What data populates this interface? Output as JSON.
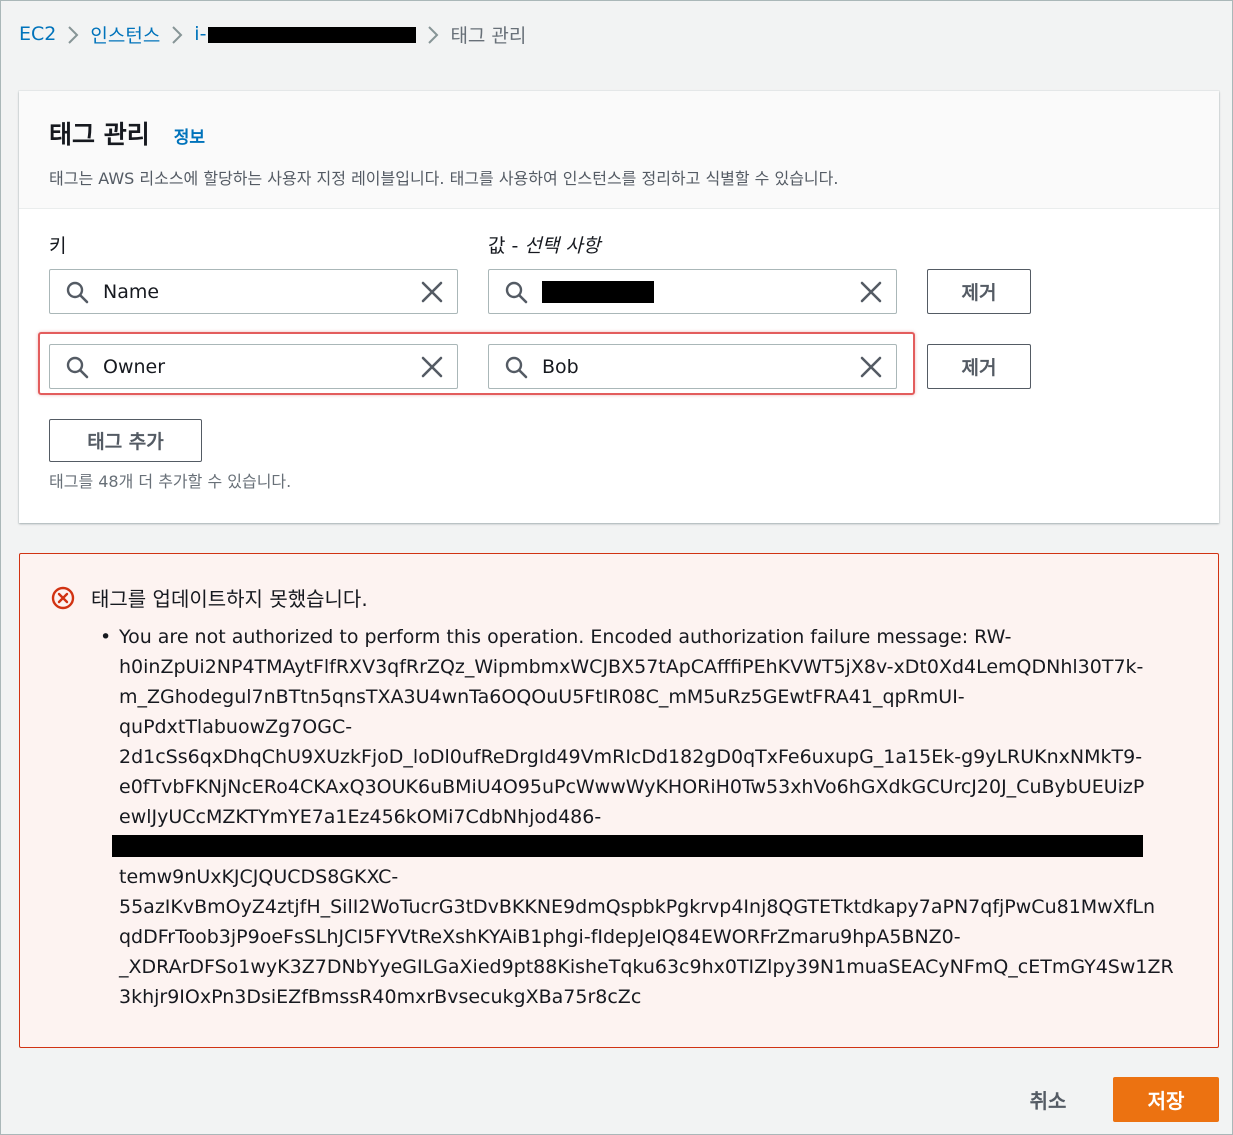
{
  "breadcrumb": {
    "ec2": "EC2",
    "instances": "인스턴스",
    "instance_id_prefix": "i-",
    "current": "태그 관리"
  },
  "panel": {
    "title": "태그 관리",
    "info": "정보",
    "description": "태그는 AWS 리소스에 할당하는 사용자 지정 레이블입니다. 태그를 사용하여 인스턴스를 정리하고 식별할 수 있습니다.",
    "key_label": "키",
    "value_label": "값 - ",
    "value_label_optional": "선택 사항"
  },
  "tags": [
    {
      "key": "Name",
      "value": "",
      "remove_label": "제거"
    },
    {
      "key": "Owner",
      "value": "Bob",
      "remove_label": "제거"
    }
  ],
  "add_tag_label": "태그 추가",
  "add_tag_hint": "태그를 48개 더 추가할 수 있습니다.",
  "alert": {
    "title": "태그를 업데이트하지 못했습니다.",
    "lines": [
      "You are not authorized to perform this operation. Encoded authorization failure message: RW-",
      "h0inZpUi2NP4TMAytFlfRXV3qfRrZQz_WipmbmxWCJBX57tApCAfffiPEhKVWT5jX8v-xDt0Xd4LemQDNhl30T7k-",
      "m_ZGhodegul7nBTtn5qnsTXA3U4wnTa6OQOuU5FtIR08C_mM5uRz5GEwtFRA41_qpRmUI-",
      "quPdxtTlabuowZg7OGC-",
      "2d1cSs6qxDhqChU9XUzkFjoD_loDl0ufReDrgId49VmRIcDd182gD0qTxFe6uxupG_1a15Ek-g9yLRUKnxNMkT9-",
      "e0fTvbFKNjNcERo4CKAxQ3OUK6uBMiU4O95uPcWwwWyKHORiH0Tw53xhVo6hGXdkGCUrcJ20J_CuBybUEUizP",
      "ewlJyUCcMZKTYmYE7a1Ez456kOMi7CdbNhjod486-",
      "",
      "temw9nUxKJCJQUCDS8GKXC-",
      "55azIKvBmOyZ4ztjfH_SilI2WoTucrG3tDvBKKNE9dmQspbkPgkrvp4Inj8QGTETktdkapy7aPN7qfjPwCu81MwXfLn",
      "qdDFrToob3jP9oeFsSLhJCI5FYVtReXshKYAiB1phgi-fIdepJeIQ84EWORFrZmaru9hpA5BNZ0-",
      "_XDRArDFSo1wyK3Z7DNbYyeGILGaXied9pt88KisheTqku63c9hx0TIZlpy39N1muaSEACyNFmQ_cETmGY4Sw1ZR",
      "3khjr9IOxPn3DsiEZfBmssR40mxrBvsecukgXBa75r8cZc"
    ]
  },
  "footer": {
    "cancel": "취소",
    "save": "저장"
  },
  "colors": {
    "link": "#0073bb",
    "primary": "#ec7211",
    "error_border": "#d13212",
    "error_bg": "#fdf3f1",
    "highlight": "#e35d5d"
  }
}
